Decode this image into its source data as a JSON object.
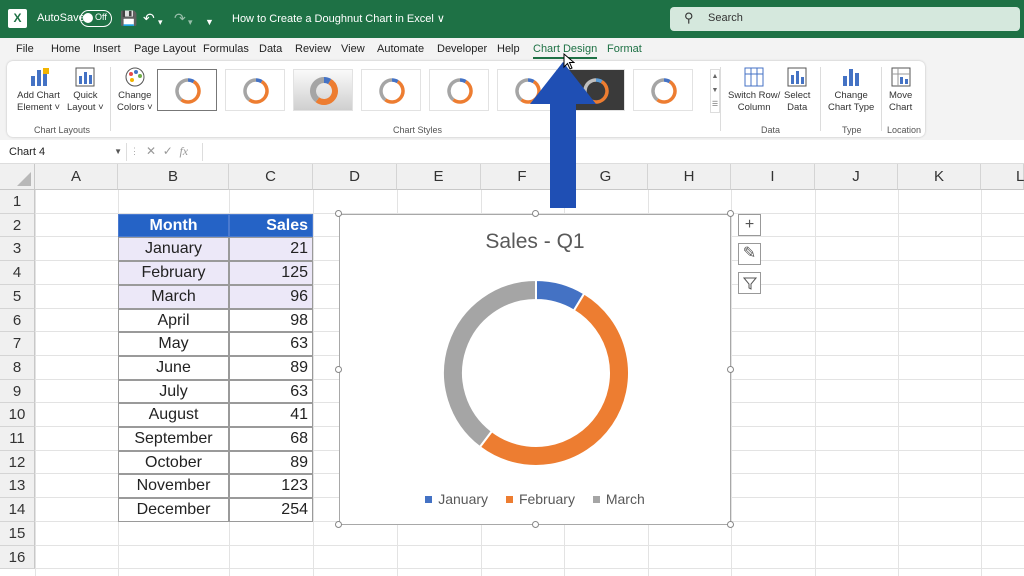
{
  "titlebar": {
    "app_icon": "X",
    "autosave_label": "AutoSave",
    "toggle_state": "Off",
    "doc_title": "How to Create a Doughnut Chart in Excel ∨",
    "search_placeholder": "Search"
  },
  "menu": [
    "File",
    "Home",
    "Insert",
    "Page Layout",
    "Formulas",
    "Data",
    "Review",
    "View",
    "Automate",
    "Developer",
    "Help",
    "Chart Design",
    "Format"
  ],
  "ribbon": {
    "add_chart_element": "Add Chart\nElement ˅",
    "quick_layout": "Quick\nLayout ˅",
    "change_colors": "Change\nColors ˅",
    "group_chart_layouts": "Chart Layouts",
    "group_chart_styles": "Chart Styles",
    "switch_row_col": "Switch Row/\nColumn",
    "select_data": "Select\nData",
    "group_data": "Data",
    "change_chart_type": "Change\nChart Type",
    "group_type": "Type",
    "move_chart": "Move\nChart",
    "group_location": "Location"
  },
  "formula_bar": {
    "name_box": "Chart 4",
    "fx": "fx"
  },
  "columns": [
    "A",
    "B",
    "C",
    "D",
    "E",
    "F",
    "G",
    "H",
    "I",
    "J",
    "K",
    "L"
  ],
  "rows": [
    "1",
    "2",
    "3",
    "4",
    "5",
    "6",
    "7",
    "8",
    "9",
    "10",
    "11",
    "12",
    "13",
    "14",
    "15",
    "16"
  ],
  "table": {
    "headers": [
      "Month",
      "Sales"
    ],
    "rows": [
      [
        "January",
        "21"
      ],
      [
        "February",
        "125"
      ],
      [
        "March",
        "96"
      ],
      [
        "April",
        "98"
      ],
      [
        "May",
        "63"
      ],
      [
        "June",
        "89"
      ],
      [
        "July",
        "63"
      ],
      [
        "August",
        "41"
      ],
      [
        "September",
        "68"
      ],
      [
        "October",
        "89"
      ],
      [
        "November",
        "123"
      ],
      [
        "December",
        "254"
      ]
    ]
  },
  "chart_data": {
    "type": "doughnut",
    "title": "Sales - Q1",
    "categories": [
      "January",
      "February",
      "March"
    ],
    "values": [
      21,
      125,
      96
    ],
    "colors": [
      "#4472c4",
      "#ed7d31",
      "#a5a5a5"
    ],
    "legend_position": "bottom"
  },
  "colors": {
    "excel_green": "#1e7145",
    "header_blue": "#2563c6",
    "arrow_blue": "#1f4fb4"
  }
}
